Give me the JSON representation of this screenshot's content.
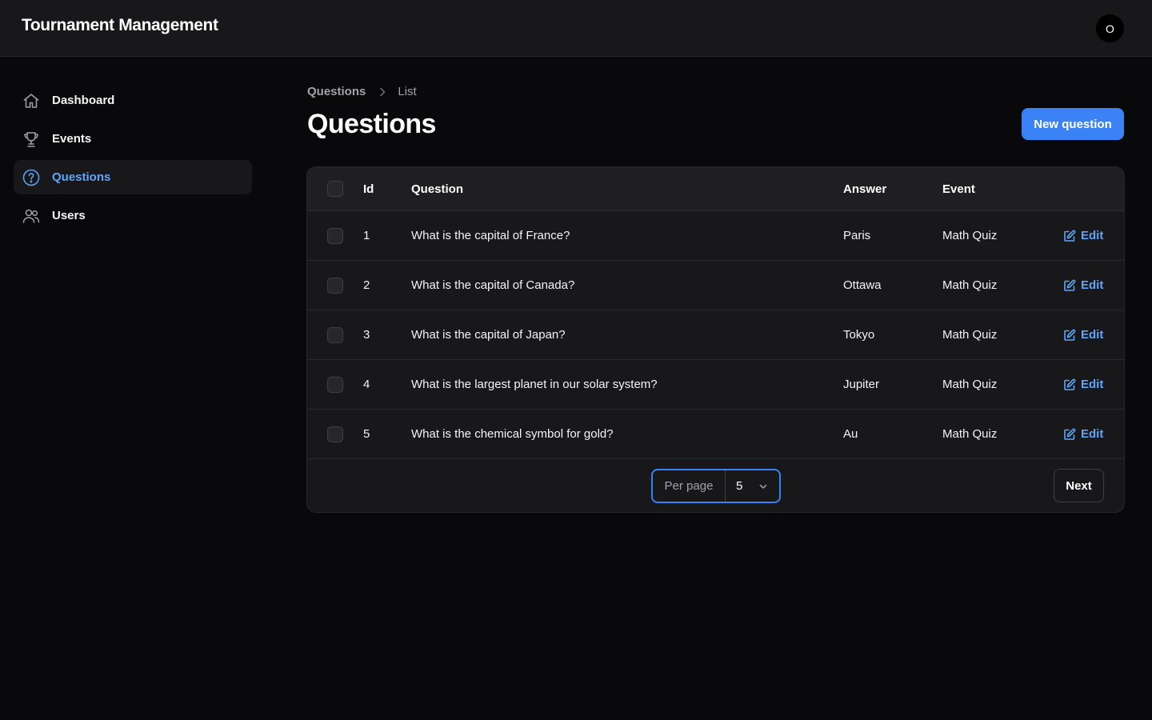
{
  "app": {
    "title": "Tournament Management",
    "user_initial": "O"
  },
  "sidebar": {
    "items": [
      {
        "label": "Dashboard",
        "icon": "home-icon"
      },
      {
        "label": "Events",
        "icon": "trophy-icon"
      },
      {
        "label": "Questions",
        "icon": "question-circle-icon",
        "active": true
      },
      {
        "label": "Users",
        "icon": "users-icon"
      }
    ]
  },
  "breadcrumb": {
    "parent": "Questions",
    "current": "List"
  },
  "page": {
    "title": "Questions",
    "new_button": "New question"
  },
  "table": {
    "headers": {
      "id": "Id",
      "question": "Question",
      "answer": "Answer",
      "event": "Event"
    },
    "edit_label": "Edit",
    "rows": [
      {
        "id": "1",
        "question": "What is the capital of France?",
        "answer": "Paris",
        "event": "Math Quiz"
      },
      {
        "id": "2",
        "question": "What is the capital of Canada?",
        "answer": "Ottawa",
        "event": "Math Quiz"
      },
      {
        "id": "3",
        "question": "What is the capital of Japan?",
        "answer": "Tokyo",
        "event": "Math Quiz"
      },
      {
        "id": "4",
        "question": "What is the largest planet in our solar system?",
        "answer": "Jupiter",
        "event": "Math Quiz"
      },
      {
        "id": "5",
        "question": "What is the chemical symbol for gold?",
        "answer": "Au",
        "event": "Math Quiz"
      }
    ]
  },
  "pagination": {
    "per_page_label": "Per page",
    "per_page_value": "5",
    "next_label": "Next"
  },
  "colors": {
    "accent": "#3b82f6",
    "link": "#60a5fa",
    "background": "#09090b",
    "surface": "#18181b"
  }
}
